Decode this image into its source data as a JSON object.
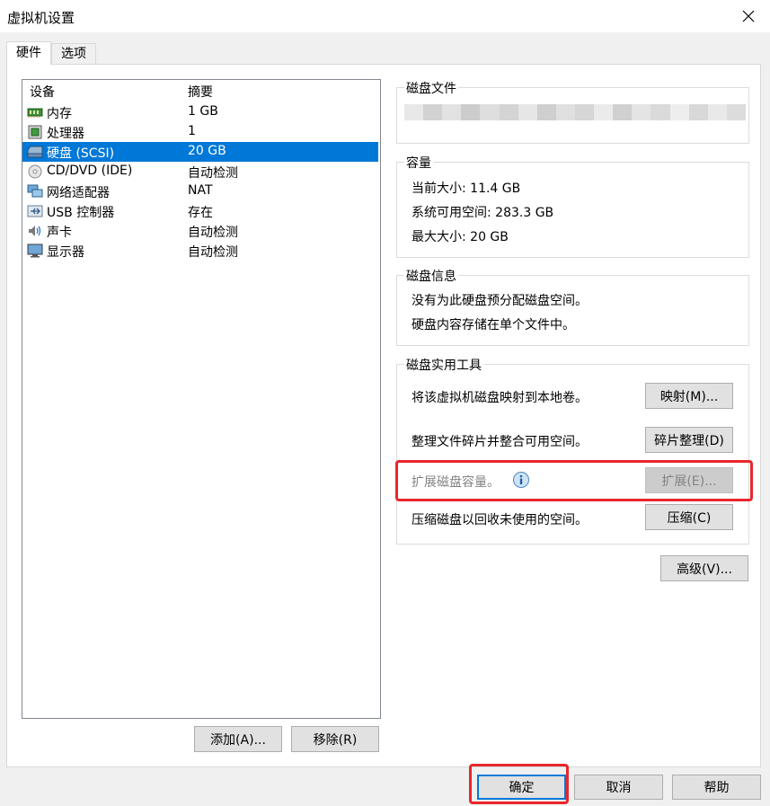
{
  "window": {
    "title": "虚拟机设置"
  },
  "tabs": [
    {
      "label": "硬件",
      "active": true
    },
    {
      "label": "选项",
      "active": false
    }
  ],
  "device_list": {
    "headers": {
      "device": "设备",
      "summary": "摘要"
    },
    "rows": [
      {
        "name": "内存",
        "summary": "1 GB",
        "icon": "memory-icon",
        "selected": false
      },
      {
        "name": "处理器",
        "summary": "1",
        "icon": "processor-icon",
        "selected": false
      },
      {
        "name": "硬盘 (SCSI)",
        "summary": "20 GB",
        "icon": "hard-disk-icon",
        "selected": true
      },
      {
        "name": "CD/DVD (IDE)",
        "summary": "自动检测",
        "icon": "cd-dvd-icon",
        "selected": false
      },
      {
        "name": "网络适配器",
        "summary": "NAT",
        "icon": "network-adapter-icon",
        "selected": false
      },
      {
        "name": "USB 控制器",
        "summary": "存在",
        "icon": "usb-icon",
        "selected": false
      },
      {
        "name": "声卡",
        "summary": "自动检测",
        "icon": "sound-card-icon",
        "selected": false
      },
      {
        "name": "显示器",
        "summary": "自动检测",
        "icon": "display-icon",
        "selected": false
      }
    ],
    "add_button": "添加(A)...",
    "remove_button": "移除(R)"
  },
  "disk_file": {
    "title": "磁盘文件"
  },
  "capacity": {
    "title": "容量",
    "current_size": "当前大小: 11.4 GB",
    "available_space": "系统可用空间: 283.3 GB",
    "max_size": "最大大小: 20 GB"
  },
  "disk_info": {
    "title": "磁盘信息",
    "line1": "没有为此硬盘预分配磁盘空间。",
    "line2": "硬盘内容存储在单个文件中。"
  },
  "utilities": {
    "title": "磁盘实用工具",
    "map_text": "将该虚拟机磁盘映射到本地卷。",
    "map_button": "映射(M)...",
    "defrag_text": "整理文件碎片并整合可用空间。",
    "defrag_button": "碎片整理(D)",
    "expand_text": "扩展磁盘容量。",
    "expand_button": "扩展(E)...",
    "compact_text": "压缩磁盘以回收未使用的空间。",
    "compact_button": "压缩(C)"
  },
  "advanced_button": "高级(V)...",
  "footer": {
    "ok": "确定",
    "cancel": "取消",
    "help": "帮助"
  },
  "colors": {
    "selection": "#0078d7",
    "highlight": "#e8262b"
  }
}
